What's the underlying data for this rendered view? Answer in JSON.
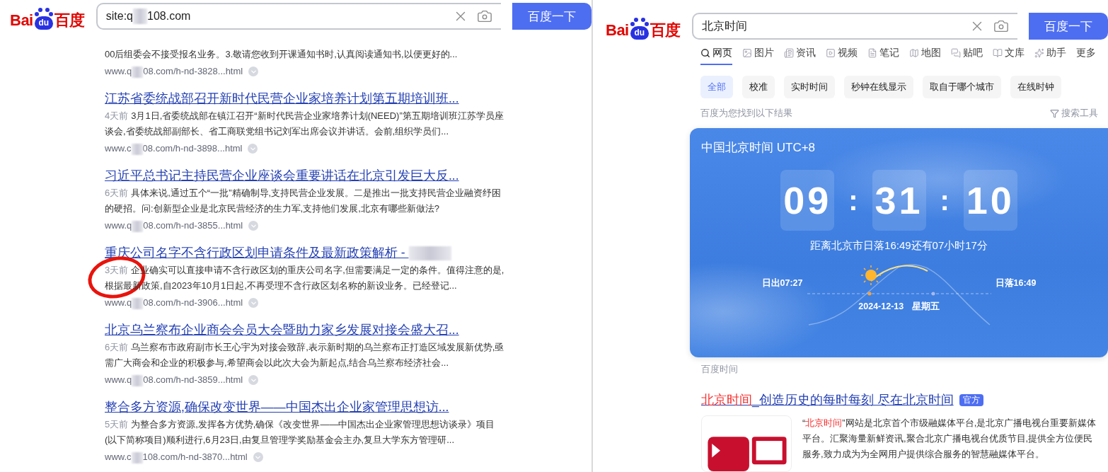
{
  "left_pane": {
    "logo": {
      "latin": "Bai",
      "paw": "du",
      "cjk": "百度"
    },
    "search": {
      "query_start": "site:q",
      "query_end": "108.com",
      "button": "百度一下"
    },
    "results": [
      {
        "title_blurred": false,
        "snippet": "00后组委会不接受报名业务。3.敬请您收到开课通知书时,认真阅读通知书,以便更好的...",
        "url_start": "www.q",
        "url_end": "08.com/h-nd-3828...html",
        "circled": false
      },
      {
        "title": "江苏省委统战部召开新时代民营企业家培养计划第五期培训班...",
        "title_blurred": false,
        "time": "4天前",
        "snippet": "3月1日,省委统战部在镇江召开“新时代民营企业家培养计划(NEED)”第五期培训班江苏学员座谈会,省委统战部副部长、省工商联党组书记刘军出席会议并讲话。会前,组织学员们...",
        "url_start": "www.c",
        "url_end": "08.com/h-nd-3898...html",
        "circled": false
      },
      {
        "title": "习近平总书记主持民营企业座谈会重要讲话在北京引发巨大反...",
        "title_blurred": false,
        "time": "6天前",
        "snippet": "具体来说,通过五个“一批”精确制导,支持民营企业发展。二是推出一批支持民营企业融资纾困的硬招。问:创新型企业是北京民营经济的生力军,支持他们发展,北京有哪些新做法?",
        "url_start": "www.q",
        "url_end": "08.com/h-nd-3855...html",
        "circled": false
      },
      {
        "title": "重庆公司名字不含行政区划申请条件及最新政策解析 - ",
        "title_blurred": true,
        "time": "3天前",
        "snippet": "企业确实可以直接申请不含行政区划的重庆公司名字,但需要满足一定的条件。值得注意的是,根据最新政策,自2023年10月1日起,不再受理不含行政区划名称的新设业务。已经登记...",
        "url_start": "www.q",
        "url_end": "08.com/h-nd-3906...html",
        "circled": true
      },
      {
        "title": "北京乌兰察布企业商会会员大会暨助力家乡发展对接会盛大召...",
        "title_blurred": false,
        "time": "6天前",
        "snippet": "乌兰察布市政府副市长王心宇为对接会致辞,表示新时期的乌兰察布正打造区域发展新优势,亟需广大商会和企业的积极参与,希望商会以此次大会为新起点,结合乌兰察布经济社会...",
        "url_start": "www.q",
        "url_end": "08.com/h-nd-3859...html",
        "circled": false
      },
      {
        "title": "整合多方资源,确保改变世界——中国杰出企业家管理思想访...",
        "title_blurred": false,
        "time": "5天前",
        "snippet": "为整合多方资源,发挥各方优势,确保《改变世界——中国杰出企业家管理思想访谈录》项目(以下简称项目)顺利进行,6月23日,由复旦管理学奖励基金会主办,复旦大学东方管理研...",
        "url_start": "www.c",
        "url_end": "108.com/h-nd-3870...html",
        "circled": false
      }
    ]
  },
  "right_pane": {
    "logo": {
      "latin": "Bai",
      "paw": "du",
      "cjk": "百度"
    },
    "search": {
      "value": "北京时间",
      "button": "百度一下"
    },
    "tabs": [
      {
        "label": "网页",
        "selected": true
      },
      {
        "label": "图片",
        "selected": false
      },
      {
        "label": "资讯",
        "selected": false
      },
      {
        "label": "视频",
        "selected": false
      },
      {
        "label": "笔记",
        "selected": false
      },
      {
        "label": "地图",
        "selected": false
      },
      {
        "label": "贴吧",
        "selected": false
      },
      {
        "label": "文库",
        "selected": false
      },
      {
        "label": "助手",
        "selected": false
      },
      {
        "label": "更多",
        "selected": false
      }
    ],
    "chips": [
      {
        "label": "全部",
        "selected": true
      },
      {
        "label": "校准",
        "selected": false
      },
      {
        "label": "实时时间",
        "selected": false
      },
      {
        "label": "秒钟在线显示",
        "selected": false
      },
      {
        "label": "取自于哪个城市",
        "selected": false
      },
      {
        "label": "在线时钟",
        "selected": false
      }
    ],
    "result_count": "百度为您找到以下结果",
    "search_tools": "搜索工具",
    "clock": {
      "title": "中国北京时间 UTC+8",
      "hours": "09",
      "minutes": "31",
      "seconds": "10",
      "separator": ":",
      "countdown": "距离北京市日落16:49还有07小时17分",
      "sunrise": "日出07:27",
      "sunset": "日落16:49",
      "date": "2024-12-13",
      "weekday": "星期五"
    },
    "clock_source": "百度时间",
    "result": {
      "title_highlight": "北京时间",
      "title_rest": "_创造历史的每时每刻 尽在北京时间",
      "badge": "官方",
      "snippet_parts": [
        {
          "text": "“",
          "highlight": false
        },
        {
          "text": "北京时间",
          "highlight": true
        },
        {
          "text": "”网站是北京首个市级融媒体平台,是北京广播电视台重要新媒体平台。汇聚海量新鲜资讯,聚合北京广播电视台优质节目,提供全方位便民服务,致力成为为全网用户提供综合服务的智慧融媒体平台。",
          "highlight": false
        }
      ]
    }
  }
}
